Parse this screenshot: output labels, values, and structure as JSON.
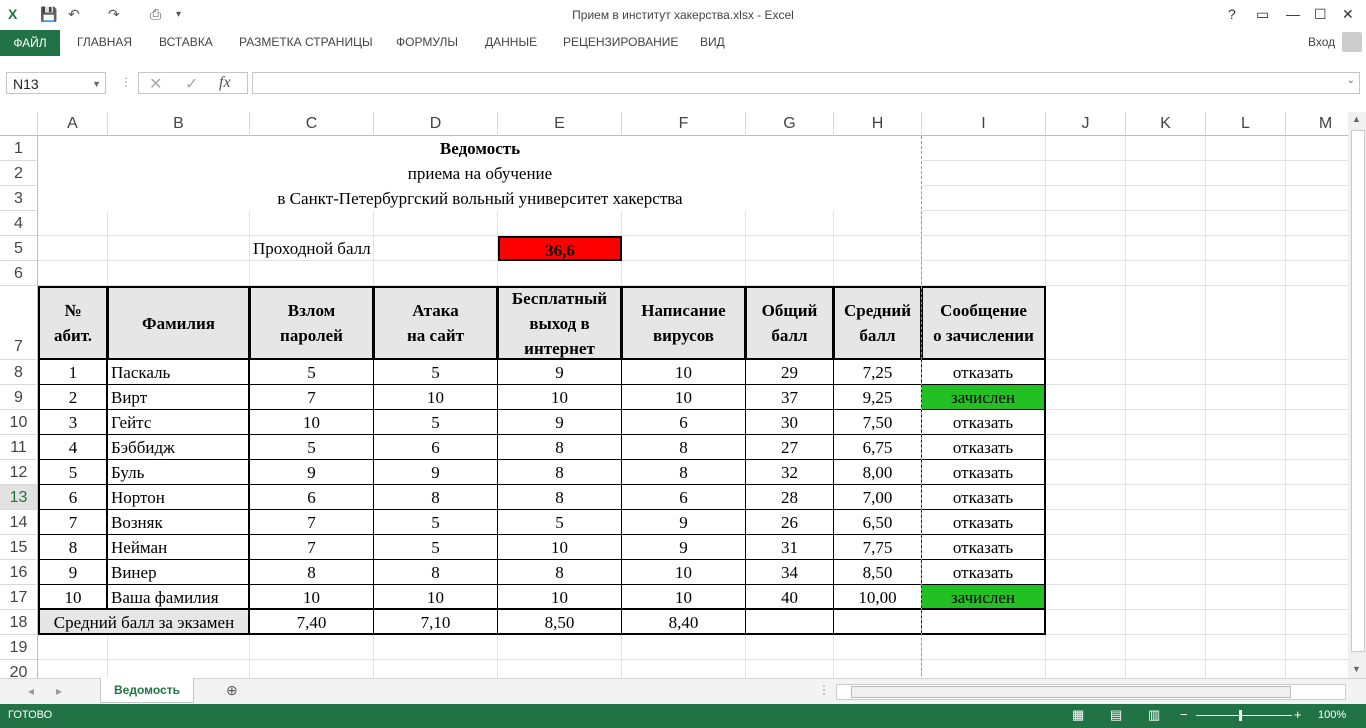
{
  "window": {
    "title": "Прием в институт хакерства.xlsx - Excel",
    "signin": "Вход"
  },
  "ribbon": {
    "file": "ФАЙЛ",
    "tabs": [
      "ГЛАВНАЯ",
      "ВСТАВКА",
      "РАЗМЕТКА СТРАНИЦЫ",
      "ФОРМУЛЫ",
      "ДАННЫЕ",
      "РЕЦЕНЗИРОВАНИЕ",
      "ВИД"
    ]
  },
  "formula_bar": {
    "name_box": "N13",
    "fx": "fx",
    "formula": ""
  },
  "grid": {
    "columns": [
      "A",
      "B",
      "C",
      "D",
      "E",
      "F",
      "G",
      "H",
      "I",
      "J",
      "K",
      "L",
      "M"
    ],
    "rows": [
      "1",
      "2",
      "3",
      "4",
      "5",
      "6",
      "7",
      "8",
      "9",
      "10",
      "11",
      "12",
      "13",
      "14",
      "15",
      "16",
      "17",
      "18",
      "19",
      "20"
    ],
    "selected_row": "13"
  },
  "sheet": {
    "title": "Ведомость",
    "subtitle1": "приема на обучение",
    "subtitle2": "в Санкт-Петербургский вольный университет хакерства",
    "pass_label": "Проходной балл",
    "pass_value": "36,6",
    "headers": [
      [
        "№",
        "абит."
      ],
      [
        "Фамилия"
      ],
      [
        "Взлом",
        "паролей"
      ],
      [
        "Атака",
        "на сайт"
      ],
      [
        "Бесплатный",
        "выход в",
        "интернет"
      ],
      [
        "Написание",
        "вирусов"
      ],
      [
        "Общий",
        "балл"
      ],
      [
        "Средний",
        "балл"
      ],
      [
        "Сообщение",
        "о зачислении"
      ]
    ],
    "data": [
      [
        "1",
        "Паскаль",
        "5",
        "5",
        "9",
        "10",
        "29",
        "7,25",
        "отказать"
      ],
      [
        "2",
        "Вирт",
        "7",
        "10",
        "10",
        "10",
        "37",
        "9,25",
        "зачислен"
      ],
      [
        "3",
        "Гейтс",
        "10",
        "5",
        "9",
        "6",
        "30",
        "7,50",
        "отказать"
      ],
      [
        "4",
        "Бэббидж",
        "5",
        "6",
        "8",
        "8",
        "27",
        "6,75",
        "отказать"
      ],
      [
        "5",
        "Буль",
        "9",
        "9",
        "8",
        "8",
        "32",
        "8,00",
        "отказать"
      ],
      [
        "6",
        "Нортон",
        "6",
        "8",
        "8",
        "6",
        "28",
        "7,00",
        "отказать"
      ],
      [
        "7",
        "Возняк",
        "7",
        "5",
        "5",
        "9",
        "26",
        "6,50",
        "отказать"
      ],
      [
        "8",
        "Нейман",
        "7",
        "5",
        "10",
        "9",
        "31",
        "7,75",
        "отказать"
      ],
      [
        "9",
        "Винер",
        "8",
        "8",
        "8",
        "10",
        "34",
        "8,50",
        "отказать"
      ],
      [
        "10",
        "Ваша фамилия",
        "10",
        "10",
        "10",
        "10",
        "40",
        "10,00",
        "зачислен"
      ]
    ],
    "avg_label": "Средний балл за экзамен",
    "avg_values": [
      "7,40",
      "7,10",
      "8,50",
      "8,40"
    ]
  },
  "colors": {
    "accent": "#217346",
    "pass_fill": "#ff0000",
    "enrolled_fill": "#22c022",
    "header_fill": "#e6e6e6"
  },
  "sheet_tabs": [
    "Ведомость"
  ],
  "status": {
    "ready": "ГОТОВО",
    "zoom": "100%"
  }
}
